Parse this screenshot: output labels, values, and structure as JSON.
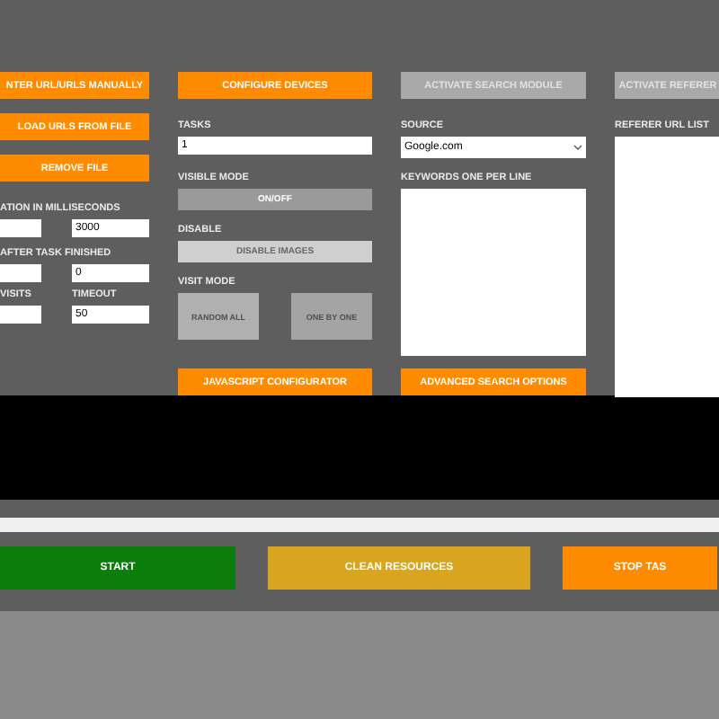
{
  "columns": [
    {
      "items": [
        {
          "kind": "button",
          "label": "NTER URL/URLS MANUALLY",
          "disabled": false
        },
        {
          "kind": "button",
          "label": "LOAD URLS FROM FILE",
          "disabled": false
        },
        {
          "kind": "button",
          "label": "REMOVE FILE",
          "disabled": false
        },
        {
          "kind": "label",
          "text": "ATION IN MILLISECONDS"
        },
        {
          "kind": "pair",
          "value": "3000"
        },
        {
          "kind": "label",
          "text": "AFTER TASK FINISHED"
        },
        {
          "kind": "pair",
          "value": "0"
        },
        {
          "kind": "pair",
          "labels": [
            "VISITS",
            "TIMEOUT"
          ],
          "value": "50"
        }
      ]
    },
    {
      "items": [
        {
          "kind": "button",
          "label": "CONFIGURE DEVICES",
          "disabled": false
        },
        {
          "kind": "label",
          "text": "TASKS"
        },
        {
          "kind": "input",
          "value": "1"
        },
        {
          "kind": "label",
          "text": "VISIBLE MODE"
        },
        {
          "kind": "toggle",
          "label": "ON/OFF"
        },
        {
          "kind": "label",
          "text": "DISABLE"
        },
        {
          "kind": "toggle",
          "label": "DISABLE IMAGES"
        },
        {
          "kind": "label",
          "text": "VISIT MODE"
        },
        {
          "kind": "modes",
          "options": [
            "RANDOM ALL",
            "ONE BY ONE"
          ]
        },
        {
          "kind": "button",
          "label": "JAVASCRIPT CONFIGURATOR",
          "disabled": false
        }
      ]
    },
    {
      "items": [
        {
          "kind": "button",
          "label": "ACTIVATE SEARCH MODULE",
          "disabled": true
        },
        {
          "kind": "label",
          "text": "SOURCE"
        },
        {
          "kind": "select",
          "value": "Google.com"
        },
        {
          "kind": "label",
          "text": "KEYWORDS ONE PER LINE"
        },
        {
          "kind": "textarea"
        },
        {
          "kind": "button",
          "label": "ADVANCED SEARCH OPTIONS",
          "disabled": false
        }
      ]
    },
    {
      "items": [
        {
          "kind": "button",
          "label": "ACTIVATE REFERER",
          "disabled": true
        },
        {
          "kind": "label",
          "text": "REFERER URL LIST"
        },
        {
          "kind": "textarea"
        }
      ]
    }
  ],
  "actions": [
    {
      "label": "START",
      "color": "#0a7d0a"
    },
    {
      "label": "CLEAN RESOURCES",
      "color": "#d9a520"
    },
    {
      "label": "STOP TAS",
      "color": "#ff8c00"
    }
  ]
}
